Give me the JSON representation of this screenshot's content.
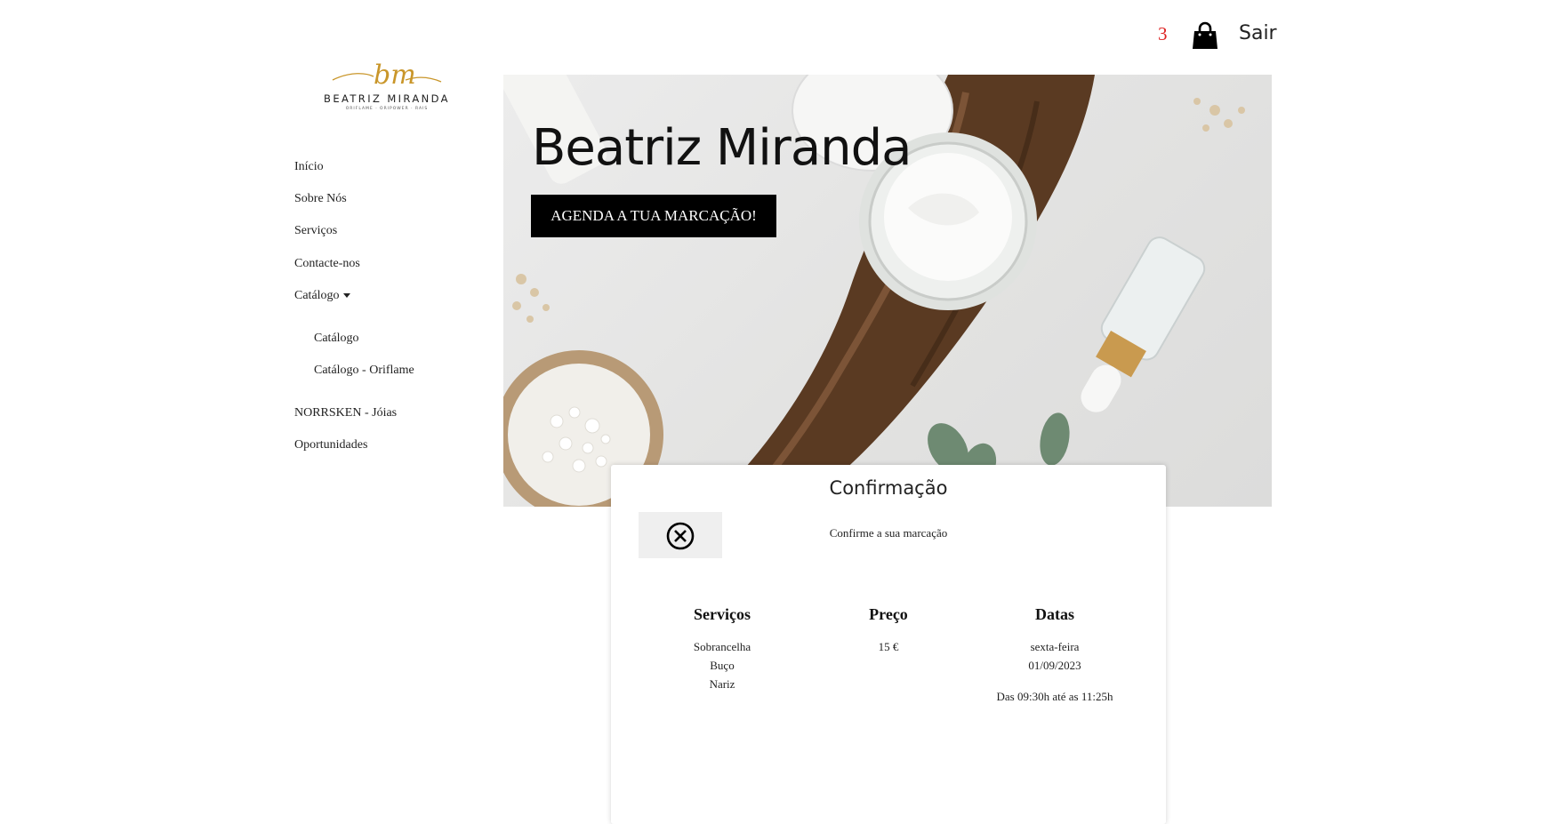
{
  "header": {
    "cart_count": "3",
    "cart_icon": "shopping-bag-icon",
    "logout_label": "Sair"
  },
  "logo": {
    "monogram": "bm",
    "name": "BEATRIZ MIRANDA",
    "tagline": "ORIFLAME · ORIPOWER · RAIS"
  },
  "nav": {
    "items": [
      {
        "label": "Início"
      },
      {
        "label": "Sobre Nós"
      },
      {
        "label": "Serviços"
      },
      {
        "label": "Contacte-nos"
      },
      {
        "label": "Catálogo"
      }
    ],
    "submenu": [
      {
        "label": "Catálogo"
      },
      {
        "label": "Catálogo - Oriflame"
      }
    ],
    "items_after": [
      {
        "label": "NORRSKEN - Jóias"
      },
      {
        "label": "Oportunidades"
      }
    ]
  },
  "hero": {
    "title": "Beatriz Miranda",
    "cta_label": "AGENDA A TUA MARCAÇÃO!"
  },
  "modal": {
    "title": "Confirmação",
    "close_icon": "close-circle-icon",
    "subtitle": "Confirme a sua marcação",
    "services_header": "Serviços",
    "services": [
      "Sobrancelha",
      "Buço",
      "Nariz"
    ],
    "price_header": "Preço",
    "price": "15 €",
    "dates_header": "Datas",
    "weekday": "sexta-feira",
    "date": "01/09/2023",
    "time_range": "Das 09:30h até as 11:25h"
  },
  "colors": {
    "accent": "#dd2222",
    "logo_gold": "#c9962a",
    "cta_bg": "#000000"
  }
}
